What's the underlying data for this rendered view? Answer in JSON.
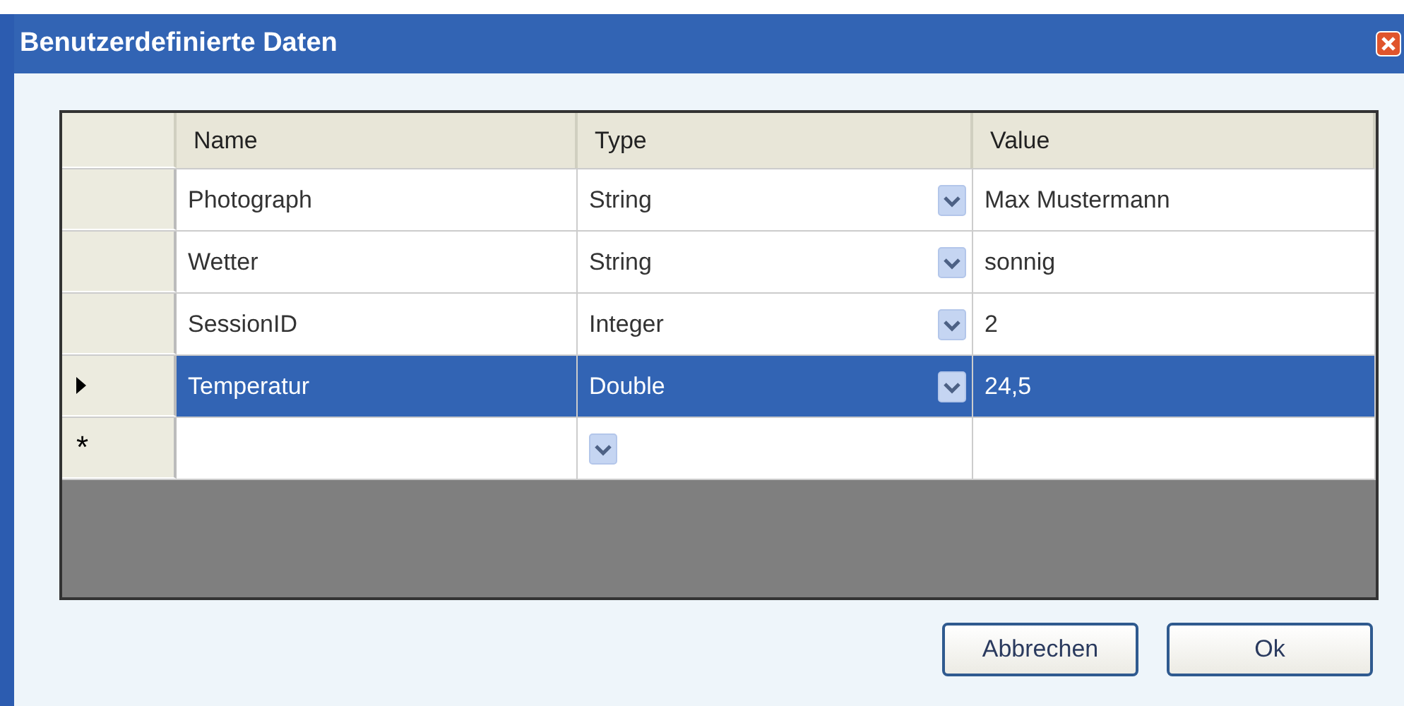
{
  "window": {
    "title": "Benutzerdefinierte Daten"
  },
  "table": {
    "columns": [
      "Name",
      "Type",
      "Value"
    ],
    "rows": [
      {
        "name": "Photograph",
        "type": "String",
        "value": "Max Mustermann",
        "selected": false
      },
      {
        "name": "Wetter",
        "type": "String",
        "value": "sonnig",
        "selected": false
      },
      {
        "name": "SessionID",
        "type": "Integer",
        "value": "2",
        "selected": false
      },
      {
        "name": "Temperatur",
        "type": "Double",
        "value": "24,5",
        "selected": true
      }
    ],
    "new_row": {
      "marker": "*"
    }
  },
  "buttons": [
    "Abbrechen",
    "Ok"
  ]
}
